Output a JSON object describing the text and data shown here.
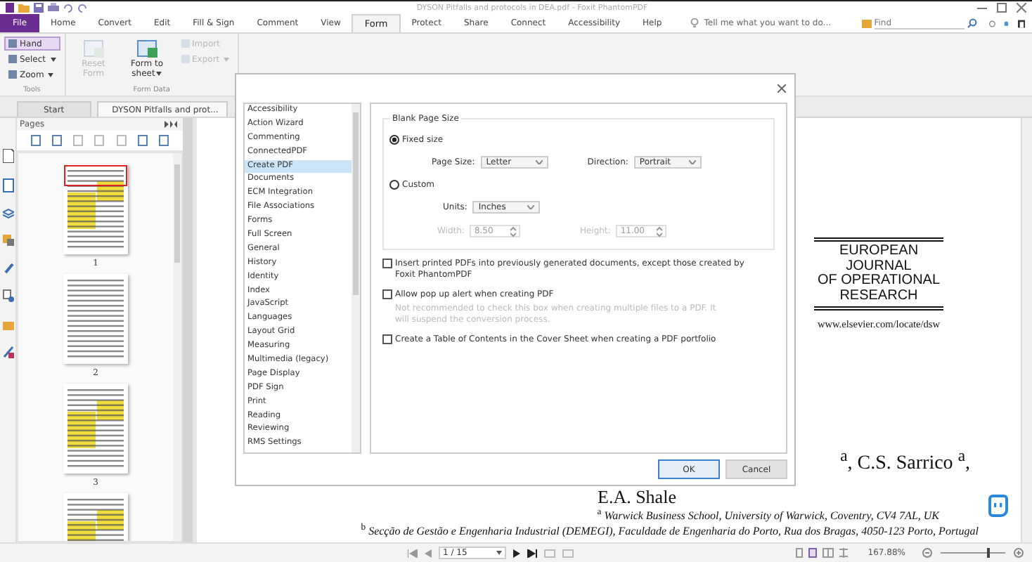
{
  "window": {
    "title": "DYSON Pitfalls and protocols in DEA.pdf - Foxit PhantomPDF"
  },
  "ribbon_tabs": [
    {
      "label": "File",
      "kind": "file",
      "selected": false
    },
    {
      "label": "Home",
      "kind": "tab",
      "selected": false
    },
    {
      "label": "Convert",
      "kind": "tab",
      "selected": false
    },
    {
      "label": "Edit",
      "kind": "tab",
      "selected": false
    },
    {
      "label": "Fill & Sign",
      "kind": "tab",
      "selected": false
    },
    {
      "label": "Comment",
      "kind": "tab",
      "selected": false
    },
    {
      "label": "View",
      "kind": "tab",
      "selected": false
    },
    {
      "label": "Form",
      "kind": "tab",
      "selected": true
    },
    {
      "label": "Protect",
      "kind": "tab",
      "selected": false
    },
    {
      "label": "Share",
      "kind": "tab",
      "selected": false
    },
    {
      "label": "Connect",
      "kind": "tab",
      "selected": false
    },
    {
      "label": "Accessibility",
      "kind": "tab",
      "selected": false
    },
    {
      "label": "Help",
      "kind": "tab",
      "selected": false
    }
  ],
  "tell_me": {
    "placeholder": "Tell me what you want to do..."
  },
  "find": {
    "placeholder": "Find"
  },
  "ribbon_groups": [
    {
      "label": "Tools",
      "commands": [
        {
          "label": "Hand",
          "kind": "small",
          "selected": true,
          "disabled": false,
          "menu": false
        },
        {
          "label": "Select",
          "kind": "small",
          "selected": false,
          "disabled": false,
          "menu": true
        },
        {
          "label": "Zoom",
          "kind": "small",
          "selected": false,
          "disabled": false,
          "menu": true
        }
      ]
    },
    {
      "label": "Form Data",
      "commands": [
        {
          "label": "Reset Form",
          "kind": "large",
          "selected": false,
          "disabled": true,
          "menu": false
        },
        {
          "label": "Form to sheet",
          "kind": "large",
          "selected": false,
          "disabled": false,
          "menu": true
        },
        {
          "label": "Import",
          "kind": "small",
          "selected": false,
          "disabled": true,
          "menu": false
        },
        {
          "label": "Export",
          "kind": "small",
          "selected": false,
          "disabled": true,
          "menu": true
        }
      ]
    }
  ],
  "doc_tabs": [
    {
      "label": "Start",
      "selected": false
    },
    {
      "label": "DYSON Pitfalls and prot...",
      "selected": true
    }
  ],
  "pages_panel": {
    "title": "Pages",
    "thumbnails": [
      {
        "label": "1",
        "selected": true,
        "highlighted": true
      },
      {
        "label": "2",
        "selected": false,
        "highlighted": false
      },
      {
        "label": "3",
        "selected": false,
        "highlighted": true
      },
      {
        "selected": false,
        "highlighted": true
      }
    ]
  },
  "document": {
    "journal_lines": [
      "EUROPEAN",
      "JOURNAL",
      "OF OPERATIONAL",
      "RESEARCH"
    ],
    "url": "www.elsevier.com/locate/dsw",
    "authors_fragment": "$^{a}$, C.S. Sarrico $^{a}$,",
    "author_line": "E.A. Shale",
    "affiliations": [
      "$^{a}$ *Warwick Business School, University of Warwick, Coventry, CV4 7AL, UK*",
      "$^{b}$ *Secção de Gestão e Engenharia Industrial (DEMEGI), Faculdade de Engenharia do Porto, Rua dos Bragas, 4050-123 Porto, Portugal*"
    ]
  },
  "dialog": {
    "categories": [
      {
        "label": "Accessibility",
        "selected": false
      },
      {
        "label": "Action Wizard",
        "selected": false
      },
      {
        "label": "Commenting",
        "selected": false
      },
      {
        "label": "ConnectedPDF",
        "selected": false
      },
      {
        "label": "Create PDF",
        "selected": true
      },
      {
        "label": "Documents",
        "selected": false
      },
      {
        "label": "ECM Integration",
        "selected": false
      },
      {
        "label": "File Associations",
        "selected": false
      },
      {
        "label": "Forms",
        "selected": false
      },
      {
        "label": "Full Screen",
        "selected": false
      },
      {
        "label": "General",
        "selected": false
      },
      {
        "label": "History",
        "selected": false
      },
      {
        "label": "Identity",
        "selected": false
      },
      {
        "label": "Index",
        "selected": false
      },
      {
        "label": "JavaScript",
        "selected": false
      },
      {
        "label": "Languages",
        "selected": false
      },
      {
        "label": "Layout Grid",
        "selected": false
      },
      {
        "label": "Measuring",
        "selected": false
      },
      {
        "label": "Multimedia (legacy)",
        "selected": false
      },
      {
        "label": "Page Display",
        "selected": false
      },
      {
        "label": "PDF Sign",
        "selected": false
      },
      {
        "label": "Print",
        "selected": false
      },
      {
        "label": "Reading",
        "selected": false
      },
      {
        "label": "Reviewing",
        "selected": false
      },
      {
        "label": "RMS Settings",
        "selected": false
      }
    ],
    "group_title": "Blank Page Size",
    "size_options": [
      {
        "label": "Fixed size",
        "selected": true
      },
      {
        "label": "Custom",
        "selected": false
      }
    ],
    "page_size": {
      "label": "Page Size:",
      "value": "Letter"
    },
    "direction": {
      "label": "Direction:",
      "value": "Portrait"
    },
    "units": {
      "label": "Units:",
      "value": "Inches"
    },
    "width": {
      "label": "Width:",
      "value": "8.50",
      "disabled": true
    },
    "height": {
      "label": "Height:",
      "value": "11.00",
      "disabled": true
    },
    "options": [
      {
        "label": "Insert printed PDFs into previously generated documents, except those created by Foxit PhantomPDF",
        "checked": false
      },
      {
        "label": "Allow pop up alert when creating PDF",
        "checked": false,
        "note": "Not recommended to check this box when creating multiple files to a PDF. It will suspend the conversion process."
      },
      {
        "label": "Create a Table of Contents in the Cover Sheet when creating a PDF portfolio",
        "checked": false
      }
    ],
    "buttons": [
      {
        "label": "OK",
        "kind": "default"
      },
      {
        "label": "Cancel",
        "kind": "normal"
      }
    ]
  },
  "status_bar": {
    "page": "1 / 15",
    "zoom": "167.88%",
    "level": 0.72
  }
}
